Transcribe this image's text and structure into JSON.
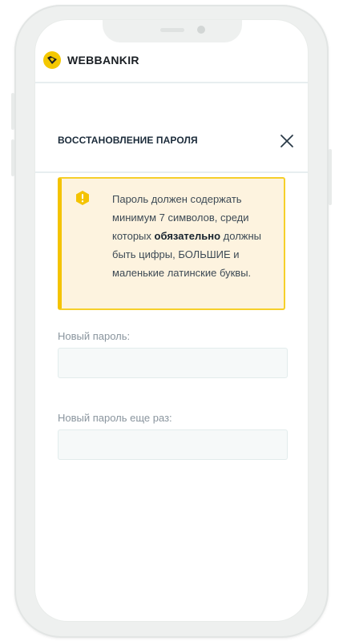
{
  "app": {
    "brand_name": "WEBBANKIR",
    "brand_color": "#f4c800"
  },
  "modal": {
    "title": "ВОССТАНОВЛЕНИЕ ПАРОЛЯ",
    "close_icon": "close-icon"
  },
  "warning": {
    "icon": "warning-hexagon-icon",
    "accent_color": "#f4c300",
    "background_color": "#fdf3df",
    "text_before": "Пароль должен содержать минимум 7 символов, среди которых ",
    "text_bold": "обязательно",
    "text_after": " должны быть цифры, БОЛЬШИЕ и маленькие латинские буквы."
  },
  "form": {
    "new_password": {
      "label": "Новый пароль:",
      "value": ""
    },
    "repeat_password": {
      "label": "Новый пароль еще раз:",
      "value": ""
    }
  }
}
